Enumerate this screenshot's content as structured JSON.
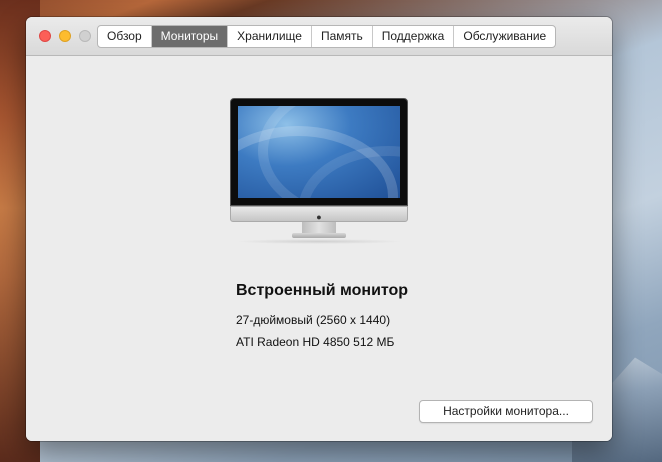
{
  "window": {
    "tabs": [
      {
        "label": "Обзор",
        "active": false
      },
      {
        "label": "Мониторы",
        "active": true
      },
      {
        "label": "Хранилище",
        "active": false
      },
      {
        "label": "Память",
        "active": false
      },
      {
        "label": "Поддержка",
        "active": false
      },
      {
        "label": "Обслуживание",
        "active": false
      }
    ],
    "traffic_lights": [
      "close-icon",
      "minimize-icon",
      "zoom-icon"
    ]
  },
  "monitor": {
    "name": "Встроенный монитор",
    "size": "27-дюймовый (2560 x 1440)",
    "graphics": "ATI Radeon HD 4850 512 МБ",
    "image_icon": "imac-icon"
  },
  "actions": {
    "settings_label": "Настройки монитора..."
  },
  "colors": {
    "active_tab": "#6d6d6d",
    "close": "#fc5f57",
    "minimize": "#fdbc2e",
    "window_bg": "#ececec"
  }
}
